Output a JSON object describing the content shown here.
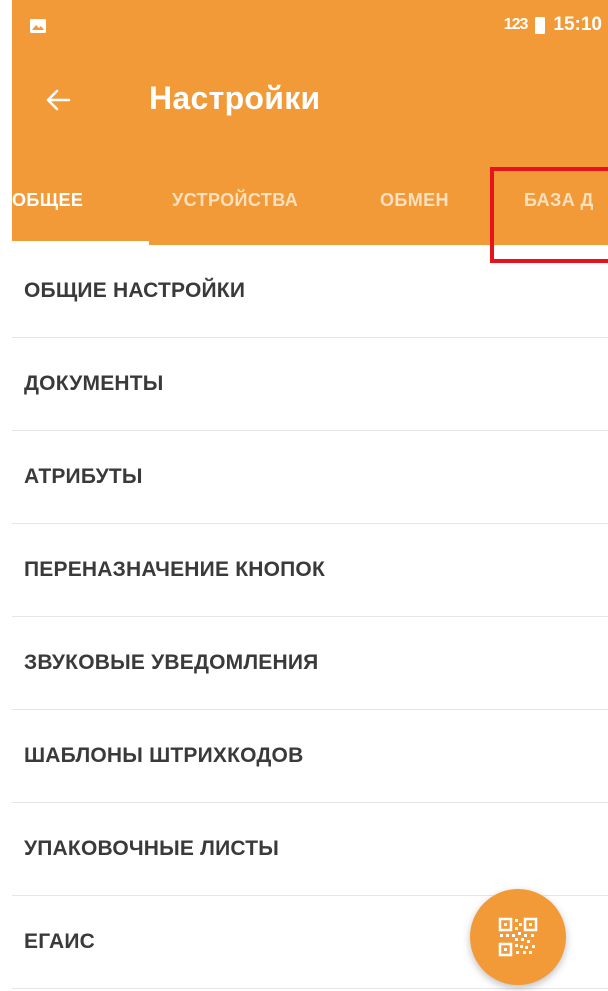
{
  "colors": {
    "appbar": "#f29a37",
    "tab_active": "#ffffff",
    "tab_inactive": "#fde0bf",
    "highlight": "#e8141b",
    "menu_text": "#3a3a3a"
  },
  "status_bar": {
    "left_icon": "gallery-icon",
    "network_label": "123",
    "battery_icon": "battery-icon",
    "time": "15:10"
  },
  "toolbar": {
    "back_icon": "arrow-left-icon",
    "title": "Настройки"
  },
  "tabs": [
    {
      "label": "ОБЩЕЕ",
      "active": true
    },
    {
      "label": "УСТРОЙСТВА",
      "active": false
    },
    {
      "label": "ОБМЕН",
      "active": false
    },
    {
      "label": "БАЗА Д",
      "active": false
    }
  ],
  "menu": {
    "items": [
      {
        "label": "ОБЩИЕ НАСТРОЙКИ"
      },
      {
        "label": "ДОКУМЕНТЫ"
      },
      {
        "label": "АТРИБУТЫ"
      },
      {
        "label": "ПЕРЕНАЗНАЧЕНИЕ КНОПОК"
      },
      {
        "label": "ЗВУКОВЫЕ УВЕДОМЛЕНИЯ"
      },
      {
        "label": "ШАБЛОНЫ ШТРИХКОДОВ"
      },
      {
        "label": "УПАКОВОЧНЫЕ ЛИСТЫ"
      },
      {
        "label": "ЕГАИС"
      }
    ]
  },
  "fab": {
    "icon": "qr-code-icon"
  }
}
